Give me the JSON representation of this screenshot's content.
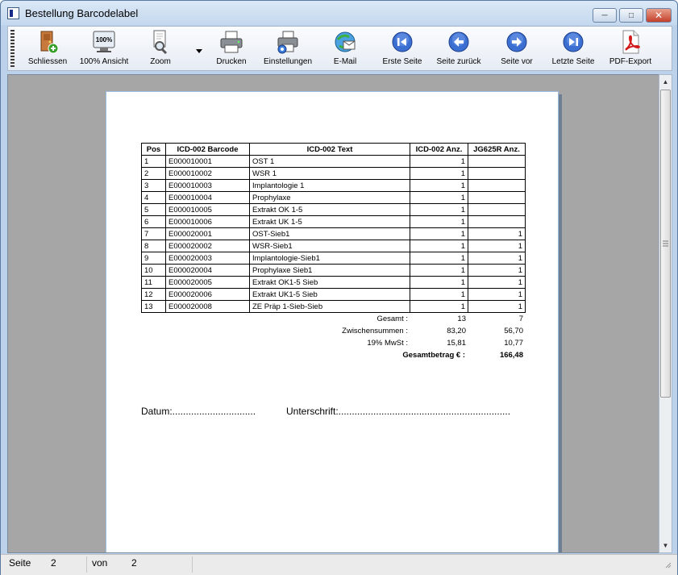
{
  "window": {
    "title": "Bestellung Barcodelabel"
  },
  "toolbar": {
    "close_label": "Schliessen",
    "fullview_label": "100% Ansicht",
    "fullview_icon_text": "100%",
    "zoom_label": "Zoom",
    "print_label": "Drucken",
    "settings_label": "Einstellungen",
    "email_label": "E-Mail",
    "first_label": "Erste Seite",
    "back_label": "Seite zurück",
    "forward_label": "Seite vor",
    "last_label": "Letzte Seite",
    "pdf_label": "PDF-Export"
  },
  "table": {
    "headers": [
      "Pos",
      "ICD-002 Barcode",
      "ICD-002 Text",
      "ICD-002 Anz.",
      "JG625R Anz."
    ],
    "rows": [
      [
        "1",
        "E000010001",
        "OST 1",
        "1",
        ""
      ],
      [
        "2",
        "E000010002",
        "WSR 1",
        "1",
        ""
      ],
      [
        "3",
        "E000010003",
        "Implantologie 1",
        "1",
        ""
      ],
      [
        "4",
        "E000010004",
        "Prophylaxe",
        "1",
        ""
      ],
      [
        "5",
        "E000010005",
        "Extrakt OK 1-5",
        "1",
        ""
      ],
      [
        "6",
        "E000010006",
        "Extrakt UK 1-5",
        "1",
        ""
      ],
      [
        "7",
        "E000020001",
        "OST-Sieb1",
        "1",
        "1"
      ],
      [
        "8",
        "E000020002",
        "WSR-Sieb1",
        "1",
        "1"
      ],
      [
        "9",
        "E000020003",
        "Implantologie-Sieb1",
        "1",
        "1"
      ],
      [
        "10",
        "E000020004",
        "Prophylaxe Sieb1",
        "1",
        "1"
      ],
      [
        "11",
        "E000020005",
        "Extrakt OK1-5 Sieb",
        "1",
        "1"
      ],
      [
        "12",
        "E000020006",
        "Extrakt UK1-5 Sieb",
        "1",
        "1"
      ],
      [
        "13",
        "E000020008",
        "ZE Präp 1-Sieb-Sieb",
        "1",
        "1"
      ]
    ]
  },
  "totals": {
    "gesamt_label": "Gesamt :",
    "gesamt_icd": "13",
    "gesamt_jg": "7",
    "zwischen_label": "Zwischensummen :",
    "zwischen_icd": "83,20",
    "zwischen_jg": "56,70",
    "mwst_label": "19% MwSt :",
    "mwst_icd": "15,81",
    "mwst_jg": "10,77",
    "betrag_label": "Gesamtbetrag € :",
    "betrag_value": "166,48"
  },
  "signature": {
    "datum": "Datum:...............................",
    "unterschrift": "Unterschrift:................................................................"
  },
  "status": {
    "seite_label": "Seite",
    "seite_value": "2",
    "von_label": "von",
    "von_value": "2"
  },
  "colors": {
    "nav_blue": "#3b6fd1",
    "pdf_red": "#d21a1a"
  }
}
